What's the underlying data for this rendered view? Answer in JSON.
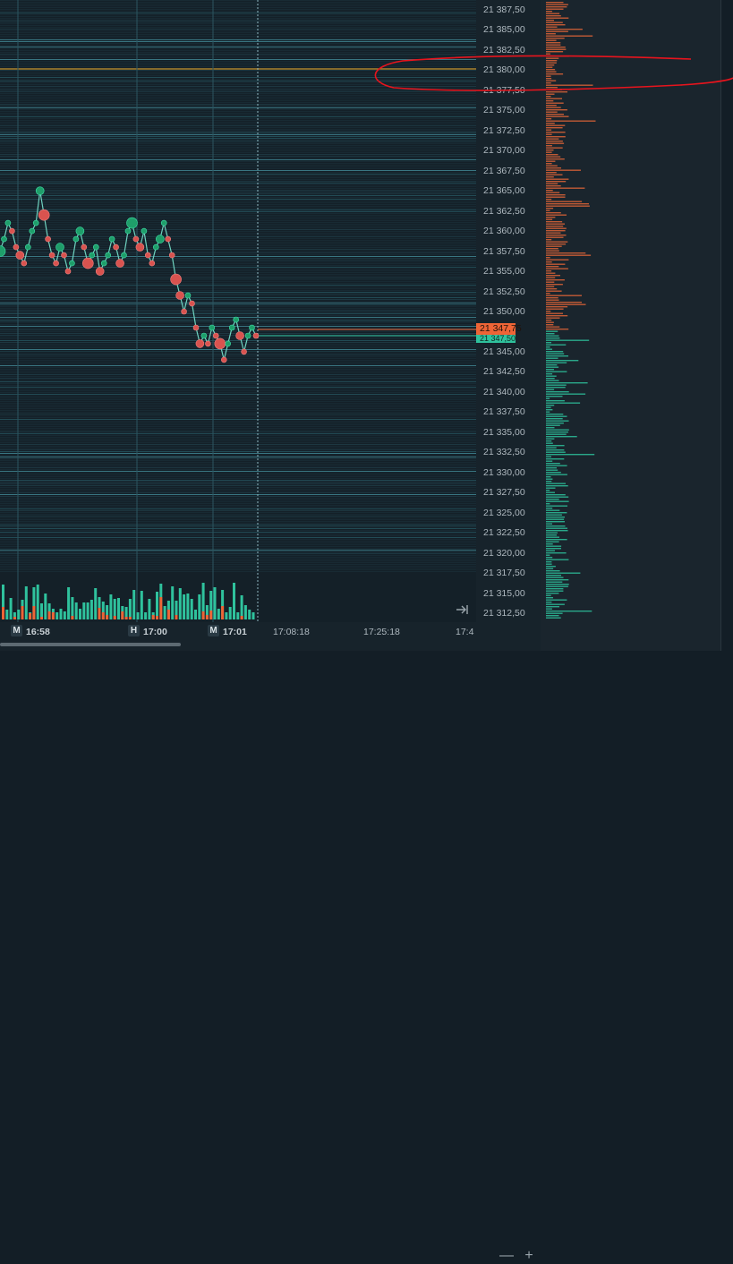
{
  "price_axis": {
    "labels": [
      "21 387,50",
      "21 385,00",
      "21 382,50",
      "21 380,00",
      "21 377,50",
      "21 375,00",
      "21 372,50",
      "21 370,00",
      "21 367,50",
      "21 365,00",
      "21 362,50",
      "21 360,00",
      "21 357,50",
      "21 355,00",
      "21 352,50",
      "21 350,00",
      "21 345,00",
      "21 342,50",
      "21 340,00",
      "21 337,50",
      "21 335,00",
      "21 332,50",
      "21 330,00",
      "21 327,50",
      "21 325,00",
      "21 322,50",
      "21 320,00",
      "21 317,50",
      "21 315,00",
      "21 312,50"
    ],
    "last_price": "21 347,75",
    "last_price_color": "#ee6436",
    "bid_price_partial": "21 347,50",
    "bid_color": "#2fc29d",
    "marked_level_color": "#c8922a"
  },
  "time_axis": {
    "badges": [
      "M",
      "H",
      "M"
    ],
    "times": [
      "16:58",
      "17:00",
      "17:01",
      "17:08:18",
      "17:25:18",
      "17:4"
    ]
  },
  "controls": {
    "zoom_out": "—",
    "zoom_in": "+"
  },
  "colors": {
    "up": "#2fc29d",
    "down": "#ee6436",
    "buy_bubble": "#1f9e6a",
    "sell_bubble": "#d9534f",
    "annotation": "#e8141d"
  },
  "chart_data": {
    "type": "line",
    "title": "",
    "series": [
      {
        "values": [
          21357.5,
          21359,
          21361,
          21360,
          21358,
          21357,
          21356,
          21358,
          21360,
          21361,
          21365,
          21362,
          21359,
          21357,
          21356,
          21358,
          21357,
          21355,
          21356,
          21359,
          21360,
          21358,
          21356,
          21357,
          21358,
          21355,
          21356,
          21357,
          21359,
          21358,
          21356,
          21357,
          21360,
          21361,
          21359,
          21358,
          21360,
          21357,
          21356,
          21358,
          21359,
          21361,
          21359,
          21357,
          21354,
          21352,
          21350,
          21352,
          21351,
          21348,
          21346,
          21347,
          21346,
          21348,
          21347,
          21346,
          21344,
          21346,
          21348,
          21349,
          21347,
          21345,
          21347,
          21348,
          21347
        ]
      }
    ],
    "x": [
      "16:56:30",
      "16:58",
      "17:00",
      "17:01"
    ],
    "ylim": [
      21311,
      21389
    ]
  }
}
